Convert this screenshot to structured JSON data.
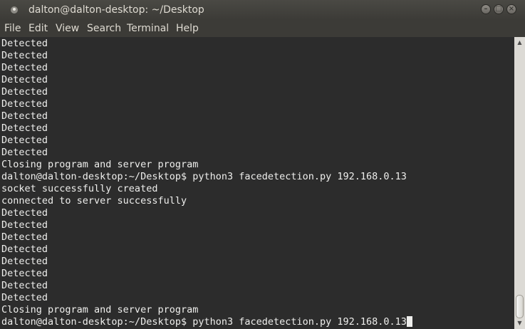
{
  "window": {
    "title": "dalton@dalton-desktop: ~/Desktop"
  },
  "menu": [
    "File",
    "Edit",
    "View",
    "Search",
    "Terminal",
    "Help"
  ],
  "terminal": {
    "lines": [
      "Detected",
      "Detected",
      "Detected",
      "Detected",
      "Detected",
      "Detected",
      "Detected",
      "Detected",
      "Detected",
      "Detected",
      "Closing program and server program",
      "dalton@dalton-desktop:~/Desktop$ python3 facedetection.py 192.168.0.13",
      "socket successfully created",
      "connected to server successfully",
      "Detected",
      "Detected",
      "Detected",
      "Detected",
      "Detected",
      "Detected",
      "Detected",
      "Detected",
      "Closing program and server program",
      "dalton@dalton-desktop:~/Desktop$ python3 facedetection.py 192.168.0.13"
    ]
  },
  "colors": {
    "terminal_bg": "#2c2c2c",
    "terminal_fg": "#eeeeec",
    "titlebar_bg": "#3c3b37"
  },
  "icons": {
    "window": "terminal-window-icon",
    "minimize": "minimize-icon",
    "maximize": "maximize-icon",
    "close": "close-icon"
  }
}
